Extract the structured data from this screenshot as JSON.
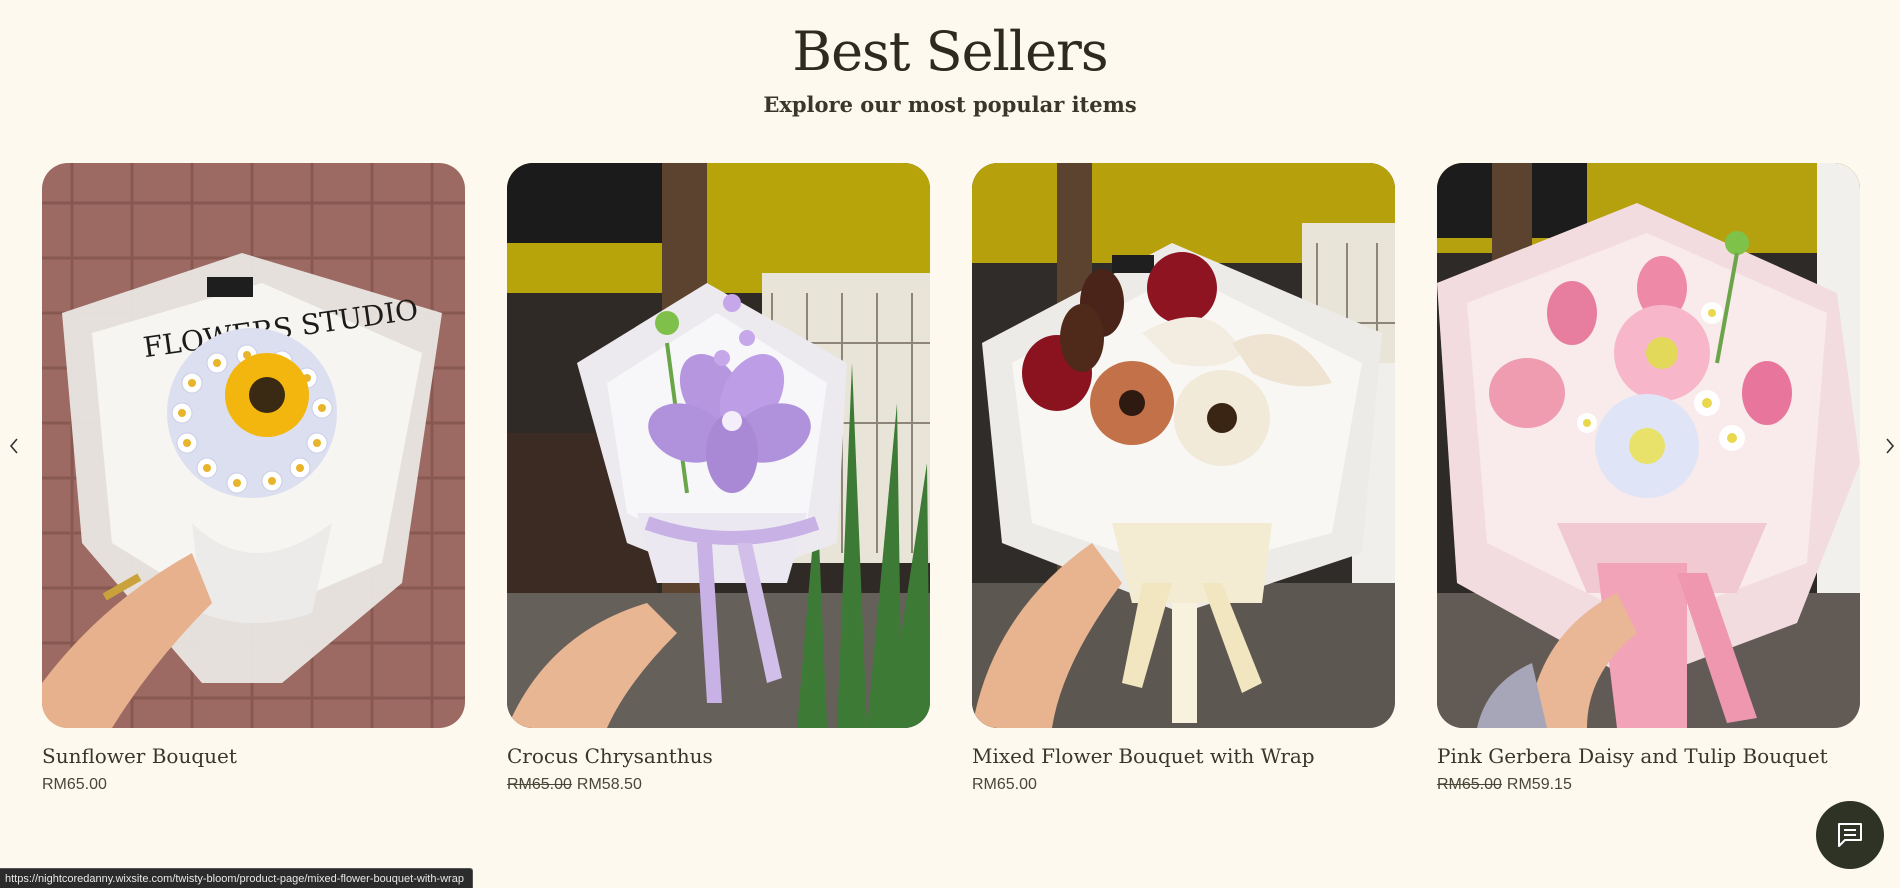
{
  "header": {
    "title": "Best Sellers",
    "subtitle": "Explore our most popular items"
  },
  "carousel": {
    "prev_icon": "chevron-left-icon",
    "next_icon": "chevron-right-icon"
  },
  "products": [
    {
      "name": "Sunflower Bouquet",
      "price": "RM65.00",
      "old_price": null,
      "wrap_text": "FLOWERS STUDIO",
      "image": "sunflower-bouquet-photo"
    },
    {
      "name": "Crocus Chrysanthus",
      "price": "RM58.50",
      "old_price": "RM65.00",
      "image": "purple-crocus-bouquet-photo"
    },
    {
      "name": "Mixed Flower Bouquet with Wrap",
      "price": "RM65.00",
      "old_price": null,
      "image": "mixed-flower-bouquet-photo"
    },
    {
      "name": "Pink Gerbera Daisy and Tulip Bouquet",
      "price": "RM59.15",
      "old_price": "RM65.00",
      "image": "pink-gerbera-tulip-bouquet-photo"
    }
  ],
  "chat": {
    "icon": "chat-icon"
  },
  "status_bar": {
    "url": "https://nightcoredanny.wixsite.com/twisty-bloom/product-page/mixed-flower-bouquet-with-wrap"
  },
  "colors": {
    "background": "#fdf9ee",
    "text": "#3a3629",
    "chat_button": "#2f3326"
  }
}
